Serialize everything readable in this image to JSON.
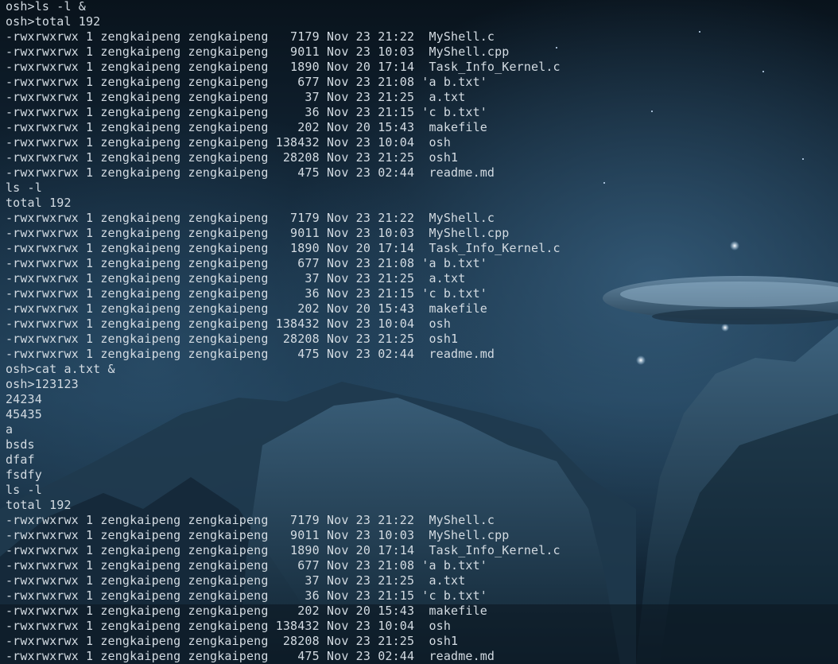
{
  "terminal": {
    "lines": [
      "osh>ls -l &",
      "osh>total 192",
      "-rwxrwxrwx 1 zengkaipeng zengkaipeng   7179 Nov 23 21:22  MyShell.c",
      "-rwxrwxrwx 1 zengkaipeng zengkaipeng   9011 Nov 23 10:03  MyShell.cpp",
      "-rwxrwxrwx 1 zengkaipeng zengkaipeng   1890 Nov 20 17:14  Task_Info_Kernel.c",
      "-rwxrwxrwx 1 zengkaipeng zengkaipeng    677 Nov 23 21:08 'a b.txt'",
      "-rwxrwxrwx 1 zengkaipeng zengkaipeng     37 Nov 23 21:25  a.txt",
      "-rwxrwxrwx 1 zengkaipeng zengkaipeng     36 Nov 23 21:15 'c b.txt'",
      "-rwxrwxrwx 1 zengkaipeng zengkaipeng    202 Nov 20 15:43  makefile",
      "-rwxrwxrwx 1 zengkaipeng zengkaipeng 138432 Nov 23 10:04  osh",
      "-rwxrwxrwx 1 zengkaipeng zengkaipeng  28208 Nov 23 21:25  osh1",
      "-rwxrwxrwx 1 zengkaipeng zengkaipeng    475 Nov 23 02:44  readme.md",
      "ls -l",
      "total 192",
      "-rwxrwxrwx 1 zengkaipeng zengkaipeng   7179 Nov 23 21:22  MyShell.c",
      "-rwxrwxrwx 1 zengkaipeng zengkaipeng   9011 Nov 23 10:03  MyShell.cpp",
      "-rwxrwxrwx 1 zengkaipeng zengkaipeng   1890 Nov 20 17:14  Task_Info_Kernel.c",
      "-rwxrwxrwx 1 zengkaipeng zengkaipeng    677 Nov 23 21:08 'a b.txt'",
      "-rwxrwxrwx 1 zengkaipeng zengkaipeng     37 Nov 23 21:25  a.txt",
      "-rwxrwxrwx 1 zengkaipeng zengkaipeng     36 Nov 23 21:15 'c b.txt'",
      "-rwxrwxrwx 1 zengkaipeng zengkaipeng    202 Nov 20 15:43  makefile",
      "-rwxrwxrwx 1 zengkaipeng zengkaipeng 138432 Nov 23 10:04  osh",
      "-rwxrwxrwx 1 zengkaipeng zengkaipeng  28208 Nov 23 21:25  osh1",
      "-rwxrwxrwx 1 zengkaipeng zengkaipeng    475 Nov 23 02:44  readme.md",
      "osh>cat a.txt &",
      "osh>123123",
      "24234",
      "45435",
      "a",
      "bsds",
      "dfaf",
      "fsdfy",
      "ls -l",
      "total 192",
      "-rwxrwxrwx 1 zengkaipeng zengkaipeng   7179 Nov 23 21:22  MyShell.c",
      "-rwxrwxrwx 1 zengkaipeng zengkaipeng   9011 Nov 23 10:03  MyShell.cpp",
      "-rwxrwxrwx 1 zengkaipeng zengkaipeng   1890 Nov 20 17:14  Task_Info_Kernel.c",
      "-rwxrwxrwx 1 zengkaipeng zengkaipeng    677 Nov 23 21:08 'a b.txt'",
      "-rwxrwxrwx 1 zengkaipeng zengkaipeng     37 Nov 23 21:25  a.txt",
      "-rwxrwxrwx 1 zengkaipeng zengkaipeng     36 Nov 23 21:15 'c b.txt'",
      "-rwxrwxrwx 1 zengkaipeng zengkaipeng    202 Nov 20 15:43  makefile",
      "-rwxrwxrwx 1 zengkaipeng zengkaipeng 138432 Nov 23 10:04  osh",
      "-rwxrwxrwx 1 zengkaipeng zengkaipeng  28208 Nov 23 21:25  osh1",
      "-rwxrwxrwx 1 zengkaipeng zengkaipeng    475 Nov 23 02:44  readme.md"
    ]
  },
  "background": {
    "image": "night-mountains-ufo-wallpaper",
    "colors": {
      "sky_dark": "#0a1520",
      "sky_mid": "#1d3a52",
      "mountain": "#2c4a60",
      "glow": "#7fa8c6"
    }
  }
}
